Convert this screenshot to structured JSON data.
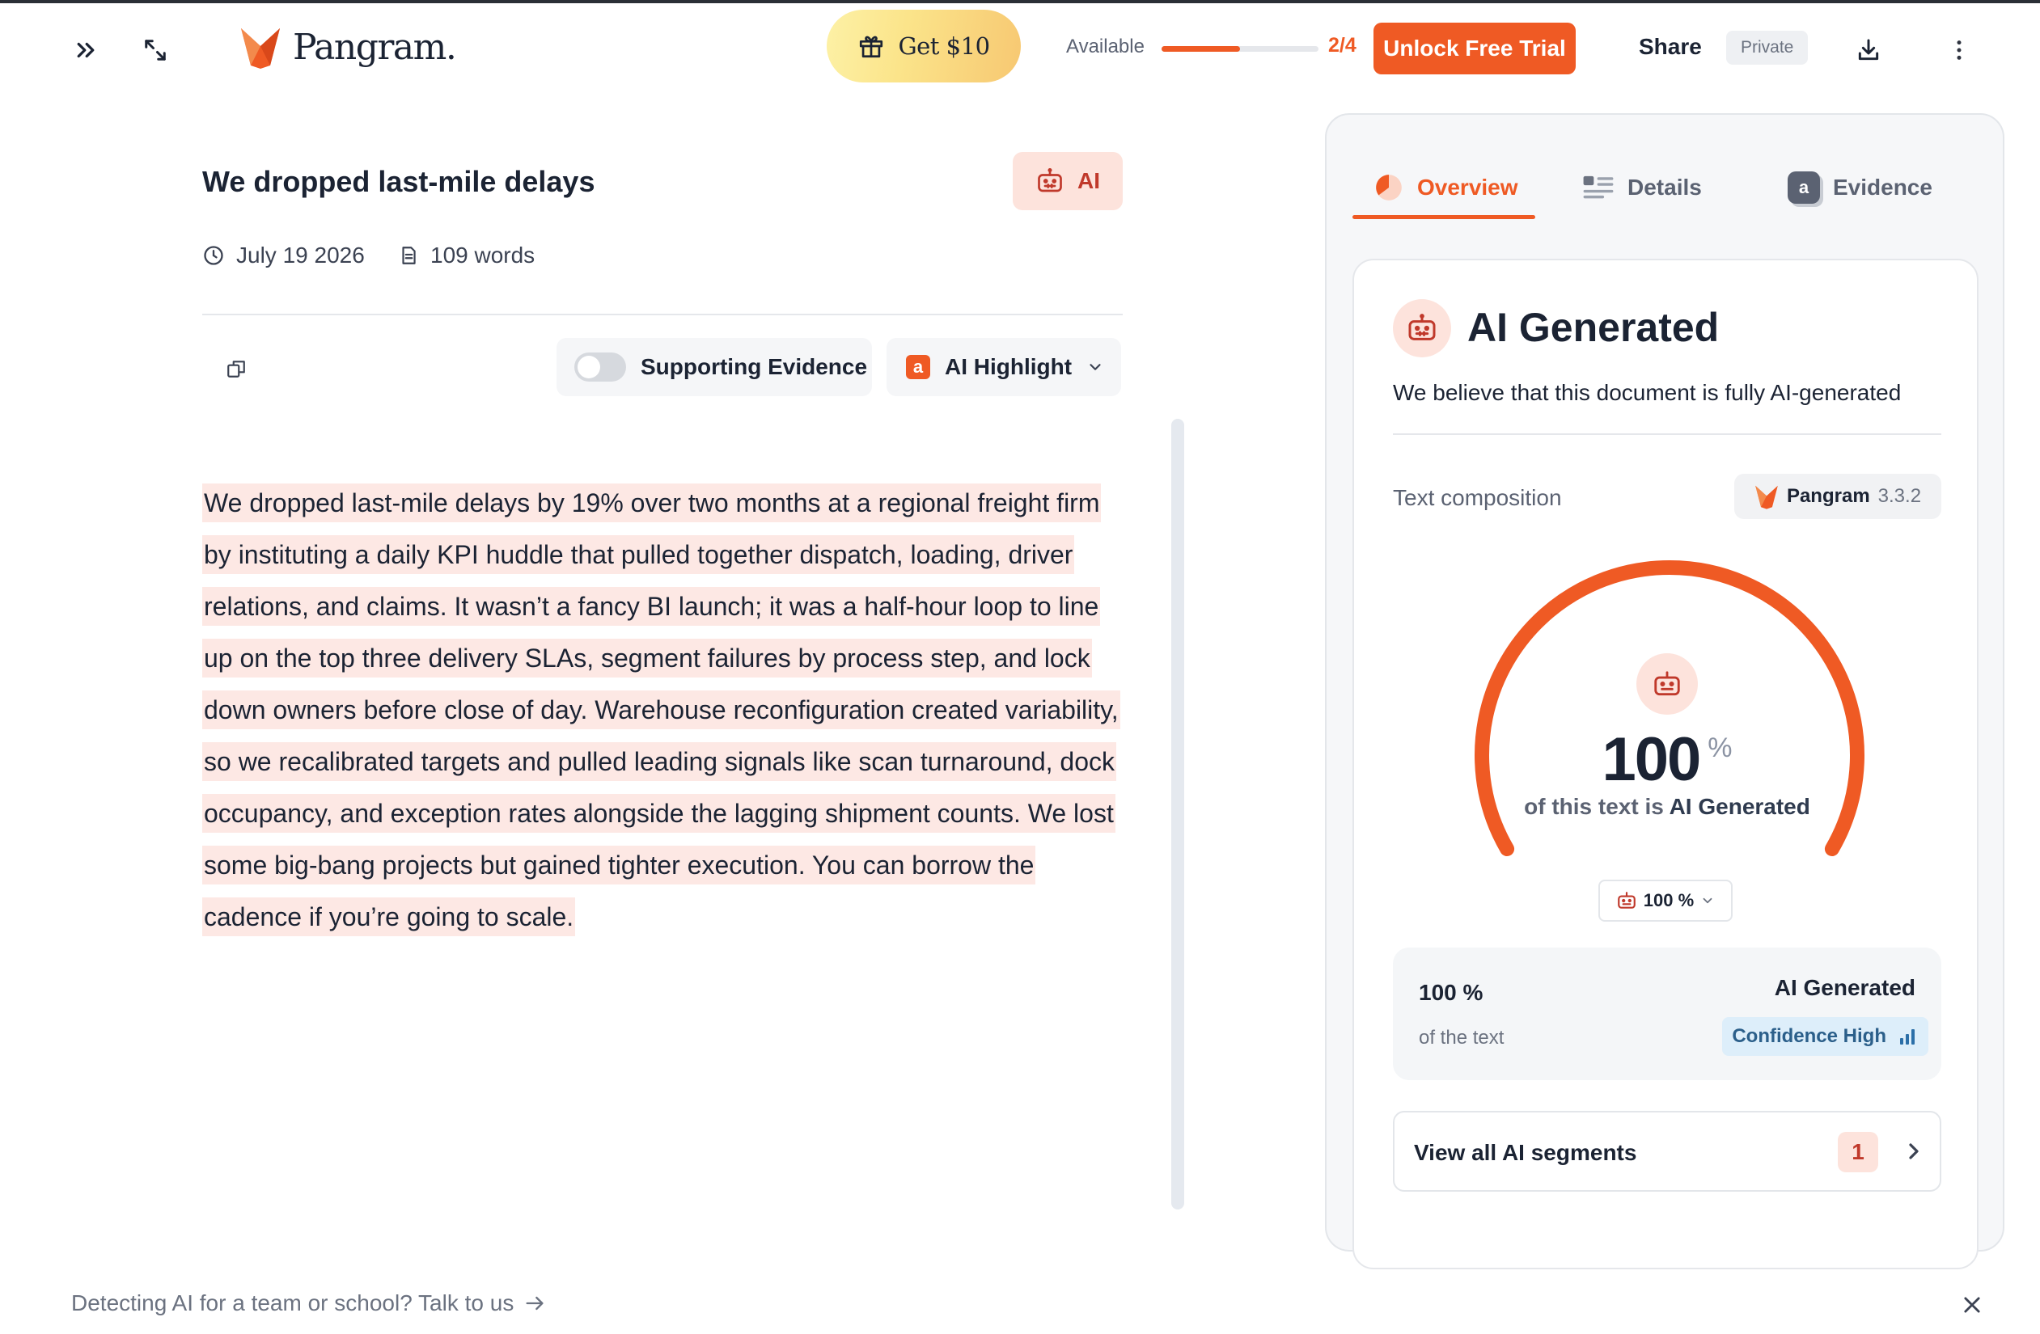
{
  "header": {
    "logo_text": "Pangram.",
    "promo_label": "Get $10",
    "available_label": "Available",
    "usage": {
      "used": 2,
      "total": 4,
      "text": "2/4",
      "fill_fraction": 0.5
    },
    "unlock_label": "Unlock Free Trial",
    "share_label": "Share",
    "visibility_label": "Private"
  },
  "document": {
    "title": "We dropped last-mile delays",
    "badge_label": "AI",
    "date": "July 19 2026",
    "word_count": "109 words",
    "supporting_evidence_label": "Supporting Evidence",
    "supporting_evidence_on": false,
    "highlight_chip": "a",
    "highlight_label": "AI Highlight",
    "body": "We dropped last-mile delays by 19% over two months at a regional freight firm by instituting a daily KPI huddle that pulled together dispatch, loading, driver relations, and claims. It wasn’t a fancy BI launch; it was a half-hour loop to line up on the top three delivery SLAs, segment failures by process step, and lock down owners before close of day. Warehouse reconfiguration created variability, so we recalibrated targets and pulled leading signals like scan turnaround, dock occupancy, and exception rates alongside the lagging shipment counts. We lost some big-bang projects but gained tighter execution. You can borrow the cadence if you’re going to scale."
  },
  "panel": {
    "tabs": [
      {
        "label": "Overview",
        "active": true
      },
      {
        "label": "Details",
        "active": false
      },
      {
        "label": "Evidence",
        "active": false
      }
    ],
    "evidence_chip": "a",
    "result_title": "AI Generated",
    "result_subtitle": "We believe that this document is fully AI-generated",
    "composition_label": "Text composition",
    "model_name": "Pangram",
    "model_version": "3.3.2",
    "gauge": {
      "value": 100,
      "value_text": "100",
      "unit": "%",
      "caption_prefix": "of this text is ",
      "caption_strong": "AI Generated"
    },
    "select_value": "100 %",
    "summary": {
      "percent": "100 %",
      "of_text": "of the text",
      "label": "AI Generated",
      "confidence": "Confidence High"
    },
    "segments_label": "View all AI segments",
    "segments_count": "1"
  },
  "footer": {
    "cta": "Detecting AI for a team or school? Talk to us"
  },
  "colors": {
    "accent": "#ef5a24",
    "ai_bg": "#fde3dc",
    "highlight": "#fde8e4",
    "confidence_bg": "#ddeefa"
  },
  "icons": [
    "chevrons-right-icon",
    "expand-icon",
    "fox-logo-icon",
    "gift-icon",
    "download-icon",
    "more-vertical-icon",
    "robot-icon",
    "clock-icon",
    "document-icon",
    "copy-icon",
    "chevron-down-icon",
    "overview-pie-icon",
    "details-list-icon",
    "evidence-icon",
    "bar-chart-icon",
    "chevron-right-icon",
    "arrow-right-icon",
    "close-icon"
  ]
}
